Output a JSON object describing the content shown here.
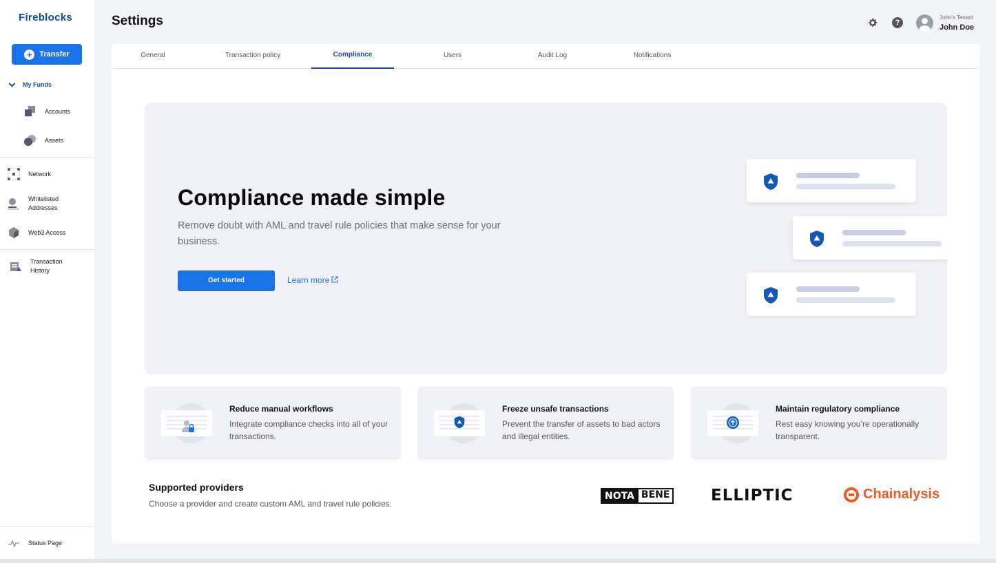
{
  "sidebar": {
    "logo": "Fireblocks",
    "transfer_label": "Transfer",
    "my_funds": "My Funds",
    "items": {
      "accounts": "Accounts",
      "assets": "Assets",
      "network": "Network",
      "whitelisted": "Whitelisted Addresses",
      "web3": "Web3 Access",
      "tx_history": "Transaction History",
      "status": "Status Page"
    }
  },
  "header": {
    "title": "Settings",
    "tenant": "John's Tenant",
    "user": "John Doe"
  },
  "tabs": [
    "General",
    "Transaction policy",
    "Compliance",
    "Users",
    "Audit Log",
    "Notifications"
  ],
  "active_tab": "Compliance",
  "hero": {
    "title": "Compliance made simple",
    "subtitle": "Remove doubt with AML and travel rule policies that make sense for your business.",
    "cta": "Get started",
    "learn_more": "Learn more"
  },
  "features": [
    {
      "title": "Reduce manual workflows",
      "text": "Integrate compliance checks into all of your transactions."
    },
    {
      "title": "Freeze unsafe transactions",
      "text": "Prevent the transfer of assets to bad actors and illegal entities."
    },
    {
      "title": "Maintain regulatory compliance",
      "text": "Rest easy knowing you’re operationally transparent."
    }
  ],
  "providers": {
    "title": "Supported providers",
    "subtitle": "Choose a provider and create custom AML and travel rule policies.",
    "logos": {
      "notabene_a": "NOTA",
      "notabene_b": "BENE",
      "elliptic": "ELLIPTIC",
      "chainalysis": "Chainalysis"
    }
  },
  "colors": {
    "accent": "#1a73e8",
    "brand": "#0b4a9e",
    "chainalysis": "#f05a28"
  }
}
